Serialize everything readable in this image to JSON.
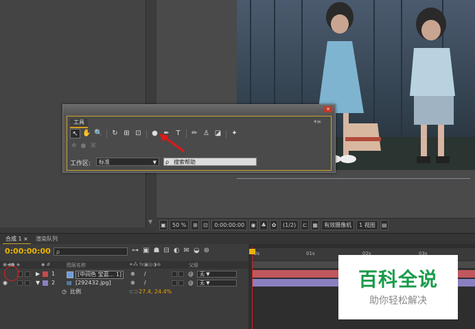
{
  "tools_panel": {
    "tab_label": "工具",
    "close_glyph": "×",
    "menu_glyph": "▾≡",
    "workspace_label": "工作区:",
    "workspace_value": "标准",
    "search_placeholder": "搜索帮助",
    "tools": [
      {
        "name": "selection-tool-icon",
        "glyph": "↖",
        "active": true
      },
      {
        "name": "hand-tool-icon",
        "glyph": "✋"
      },
      {
        "name": "zoom-tool-icon",
        "glyph": "🔍"
      },
      {
        "name": "rotate-tool-icon",
        "glyph": "↻"
      },
      {
        "name": "camera-tool-icon",
        "glyph": "⊞"
      },
      {
        "name": "pan-behind-tool-icon",
        "glyph": "⊡"
      },
      {
        "name": "ellipse-tool-icon",
        "glyph": "●"
      },
      {
        "name": "pen-tool-icon",
        "glyph": "✒"
      },
      {
        "name": "text-tool-icon",
        "glyph": "T"
      },
      {
        "name": "brush-tool-icon",
        "glyph": "✏"
      },
      {
        "name": "clone-stamp-tool-icon",
        "glyph": "♙"
      },
      {
        "name": "eraser-tool-icon",
        "glyph": "◪"
      },
      {
        "name": "puppet-tool-icon",
        "glyph": "✦"
      }
    ]
  },
  "viewer_bar": {
    "zoom": "50 %",
    "timecode": "0:00:00:00",
    "resolution": "(1/2)",
    "camera": "有效摄像机",
    "views": "1 视图"
  },
  "timeline": {
    "tabs": [
      "合成 1 ×",
      "渲染队列"
    ],
    "timecode": "0:00:00:00",
    "search_placeholder": "ρ",
    "column_layer_name": "图层名称",
    "column_parent": "父级",
    "ruler_ticks": [
      "0s",
      "01s",
      "02s",
      "03s"
    ],
    "layers": [
      {
        "index": "1",
        "name": "[中间色 宝蓝... 1]",
        "color": "#c84a4a",
        "parent": "无"
      },
      {
        "index": "2",
        "name": "[292432.jpg]",
        "color": "#8a7fc0",
        "parent": "无"
      }
    ],
    "property": {
      "name": "比例",
      "value": "27.4, 24.4%"
    }
  },
  "watermark": {
    "main": "百科全说",
    "sub": "助你轻松解决"
  }
}
